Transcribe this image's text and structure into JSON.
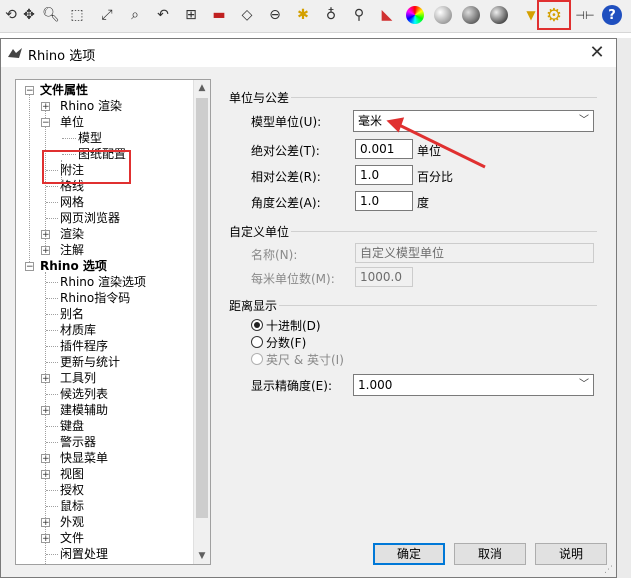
{
  "toolbar": {
    "icons": [
      "rotate-icon",
      "zoom-icon",
      "zoom-window-icon",
      "zoom-extents-icon",
      "zoom-selected-icon",
      "undo-view-icon",
      "four-viewports-icon",
      "car-icon",
      "grid-icon",
      "dimension-icon",
      "light-icon",
      "light-bulb-icon",
      "pen-icon",
      "color-wheel-icon",
      "sphere-gray-icon",
      "sphere-shaded-icon",
      "sphere-dark-icon",
      "sphere-blue-icon",
      "filter-icon",
      "options-gear-icon",
      "layout-icon",
      "help-icon"
    ],
    "help_glyph": "?"
  },
  "dialog": {
    "title": "Rhino 选项",
    "close_glyph": "✕"
  },
  "tree": {
    "doc_props": "文件属性",
    "rhino_render": "Rhino 渲染",
    "units": "单位",
    "model": "模型",
    "layout": "图纸配置",
    "notes": "附注",
    "grid": "格线",
    "mesh": "网格",
    "web_browser": "网页浏览器",
    "render": "渲染",
    "annotation": "注解",
    "rhino_options": "Rhino 选项",
    "rhino_render_options": "Rhino 渲染选项",
    "rhino_script": "Rhino指令码",
    "aliases": "别名",
    "libraries": "材质库",
    "plugins": "插件程序",
    "updates": "更新与统计",
    "toolbars": "工具列",
    "selection_menu": "候选列表",
    "modeling_aids": "建模辅助",
    "keyboard": "键盘",
    "alerter": "警示器",
    "popup_menu": "快显菜单",
    "view": "视图",
    "licenses": "授权",
    "mouse": "鼠标",
    "appearance": "外观",
    "files": "文件",
    "idle": "闲置处理"
  },
  "units_panel": {
    "section_title": "单位与公差",
    "model_units_label": "模型单位(U):",
    "model_units_value": "毫米",
    "abs_tol_label": "绝对公差(T):",
    "abs_tol_value": "0.001",
    "abs_tol_unit": "单位",
    "rel_tol_label": "相对公差(R):",
    "rel_tol_value": "1.0",
    "rel_tol_unit": "百分比",
    "ang_tol_label": "角度公差(A):",
    "ang_tol_value": "1.0",
    "ang_tol_unit": "度"
  },
  "custom_units": {
    "section_title": "自定义单位",
    "name_label": "名称(N):",
    "name_value": "自定义模型单位",
    "per_meter_label": "每米单位数(M):",
    "per_meter_value": "1000.0"
  },
  "distance_display": {
    "section_title": "距离显示",
    "decimal_label": "十进制(D)",
    "fractional_label": "分数(F)",
    "feet_inches_label": "英尺 & 英寸(I)",
    "precision_label": "显示精确度(E):",
    "precision_value": "1.000"
  },
  "buttons": {
    "ok": "确定",
    "cancel": "取消",
    "help": "说明"
  },
  "colors": {
    "highlight_red": "#e03030",
    "focus_blue": "#0078d7"
  }
}
